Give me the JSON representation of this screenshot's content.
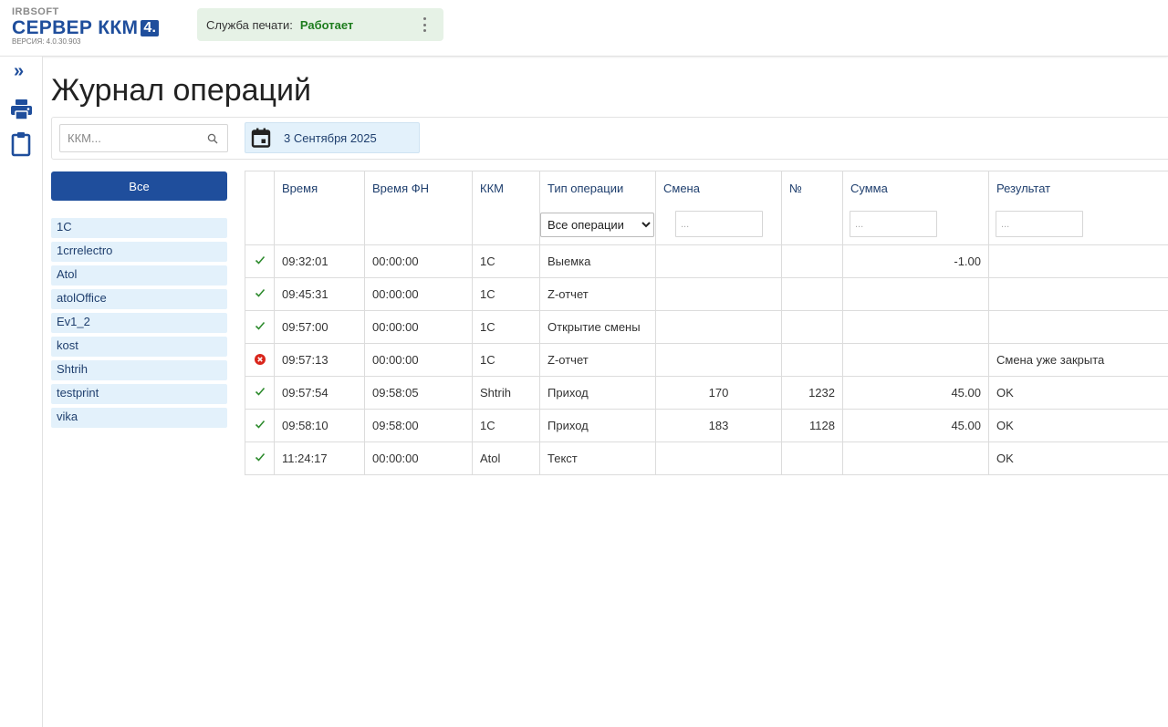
{
  "app": {
    "brand": "IRBSOFT",
    "title": "СЕРВЕР ККМ",
    "title_badge": "4.",
    "version": "ВЕРСИЯ: 4.0.30.903"
  },
  "service": {
    "label": "Служба печати:",
    "status": "Работает",
    "status_color": "#1e7d1e"
  },
  "rail": {
    "expand_glyph": "»",
    "icons": [
      "printer-icon",
      "clipboard-icon"
    ]
  },
  "page": {
    "title": "Журнал операций"
  },
  "toolbar": {
    "search_placeholder": "ККМ...",
    "date": "3 Сентября 2025"
  },
  "kkm_filter": {
    "all_label": "Все",
    "items": [
      "1C",
      "1crrelectro",
      "Atol",
      "atolOffice",
      "Ev1_2",
      "kost",
      "Shtrih",
      "testprint",
      "vika"
    ]
  },
  "table": {
    "headers": {
      "time": "Время",
      "time_fn": "Время ФН",
      "kkm": "ККМ",
      "op_type": "Тип операции",
      "shift": "Смена",
      "number": "№",
      "sum": "Сумма",
      "result": "Результат"
    },
    "filters": {
      "op_type_selected": "Все операции",
      "shift_placeholder": "...",
      "sum_placeholder": "...",
      "result_placeholder": "..."
    },
    "rows": [
      {
        "status": "ok",
        "time": "09:32:01",
        "time_fn": "00:00:00",
        "kkm": "1C",
        "op_type": "Выемка",
        "shift": "",
        "number": "",
        "sum": "-1.00",
        "result": ""
      },
      {
        "status": "ok",
        "time": "09:45:31",
        "time_fn": "00:00:00",
        "kkm": "1C",
        "op_type": "Z-отчет",
        "shift": "",
        "number": "",
        "sum": "",
        "result": ""
      },
      {
        "status": "ok",
        "time": "09:57:00",
        "time_fn": "00:00:00",
        "kkm": "1C",
        "op_type": "Открытие смены",
        "shift": "",
        "number": "",
        "sum": "",
        "result": ""
      },
      {
        "status": "error",
        "time": "09:57:13",
        "time_fn": "00:00:00",
        "kkm": "1C",
        "op_type": "Z-отчет",
        "shift": "",
        "number": "",
        "sum": "",
        "result": "Смена уже закрыта"
      },
      {
        "status": "ok",
        "time": "09:57:54",
        "time_fn": "09:58:05",
        "kkm": "Shtrih",
        "op_type": "Приход",
        "shift": "170",
        "number": "1232",
        "sum": "45.00",
        "result": "OK"
      },
      {
        "status": "ok",
        "time": "09:58:10",
        "time_fn": "09:58:00",
        "kkm": "1C",
        "op_type": "Приход",
        "shift": "183",
        "number": "1128",
        "sum": "45.00",
        "result": "OK"
      },
      {
        "status": "ok",
        "time": "11:24:17",
        "time_fn": "00:00:00",
        "kkm": "Atol",
        "op_type": "Текст",
        "shift": "",
        "number": "",
        "sum": "",
        "result": "OK"
      }
    ]
  },
  "colors": {
    "accent": "#1f4e9c",
    "light_blue": "#e3f1fb",
    "ok_green": "#2e8b2e",
    "error_red": "#d9261c"
  }
}
